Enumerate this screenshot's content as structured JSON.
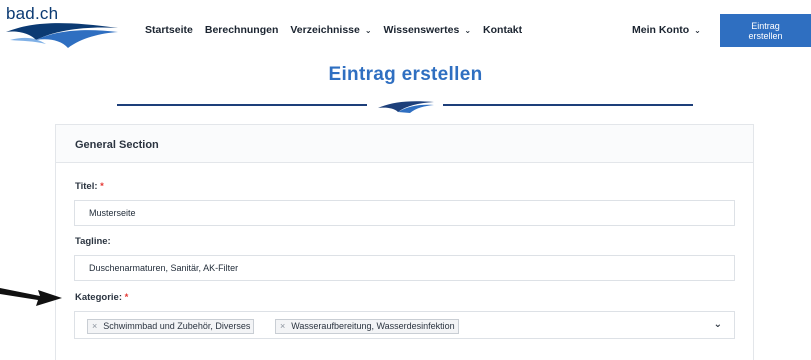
{
  "header": {
    "logo_text": "bad.ch",
    "nav": [
      {
        "label": "Startseite",
        "has_dropdown": false
      },
      {
        "label": "Berechnungen",
        "has_dropdown": false
      },
      {
        "label": "Verzeichnisse",
        "has_dropdown": true
      },
      {
        "label": "Wissenswertes",
        "has_dropdown": true
      },
      {
        "label": "Kontakt",
        "has_dropdown": false
      }
    ],
    "account_label": "Mein Konto",
    "cta_line1": "Eintrag",
    "cta_line2": "erstellen"
  },
  "page": {
    "title": "Eintrag erstellen"
  },
  "form": {
    "section_title": "General Section",
    "title_label": "Titel:",
    "title_value": "Musterseite",
    "tagline_label": "Tagline:",
    "tagline_value": "Duschenarmaturen, Sanitär, AK-Filter",
    "category_label": "Kategorie:",
    "required_mark": "*",
    "categories": [
      {
        "remove": "×",
        "label": "Schwimmbad und Zubehör, Diverses"
      },
      {
        "remove": "×",
        "label": "Wasseraufbereitung, Wasserdesinfektion"
      }
    ]
  },
  "colors": {
    "accent": "#2f6fc1",
    "logo_blue": "#0b3a73",
    "required": "#e53935"
  }
}
